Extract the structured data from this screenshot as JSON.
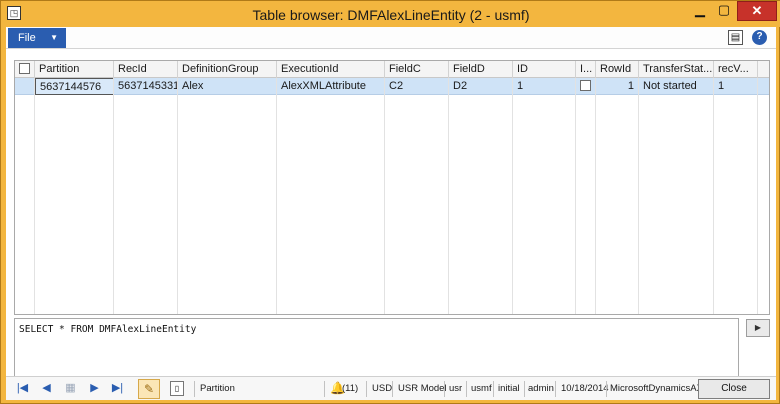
{
  "window": {
    "title": "Table browser: DMFAlexLineEntity (2 - usmf)",
    "app_icon": "app-window-icon",
    "controls": {
      "minimize": "▁",
      "maximize": "▢",
      "close": "✕"
    }
  },
  "toolbar": {
    "file_label": "File",
    "file_caret": "▼",
    "layout_icon": "layout-icon",
    "help_icon": "help-icon",
    "help_glyph": "?"
  },
  "grid": {
    "columns": [
      "Partition",
      "RecId",
      "DefinitionGroup",
      "ExecutionId",
      "FieldC",
      "FieldD",
      "ID",
      "I...",
      "RowId",
      "TransferStat...",
      "recV..."
    ],
    "rows": [
      {
        "partition": "5637144576",
        "recid": "5637145331",
        "definition_group": "Alex",
        "execution_id": "AlexXMLAttribute",
        "field_c": "C2",
        "field_d": "D2",
        "id": "1",
        "i_checked": false,
        "row_id": "1",
        "transfer_status": "Not started",
        "rec_version": "1"
      }
    ]
  },
  "query": {
    "text": "SELECT * FROM DMFAlexLineEntity",
    "run_glyph": "▶"
  },
  "statusbar": {
    "nav": {
      "first": "|◀",
      "prev": "◀",
      "grid": "▦",
      "next": "▶",
      "last": "▶|"
    },
    "edit_icon": "pencil-icon",
    "clip_icon": "attachment-icon",
    "field": "Partition",
    "notifications": "(11)",
    "currency": "USD",
    "model": "USR Model",
    "layer": "usr",
    "company": "usmf",
    "partition": "initial",
    "user": "admin",
    "date": "10/18/2014",
    "server": "MicrosoftDynamicsAX",
    "close_label": "Close"
  }
}
